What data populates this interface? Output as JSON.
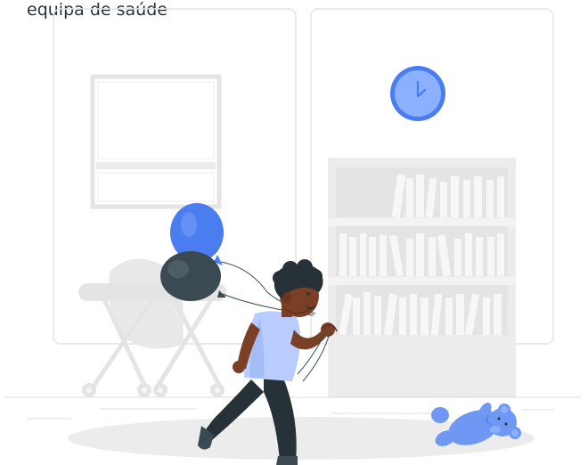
{
  "caption": "equipa de saúde",
  "colors": {
    "accent": "#4a7df0",
    "accent_light": "#8ab0ff",
    "line_gray": "#e4e4e4",
    "fill_gray": "#ececec",
    "dark": "#263238",
    "skin": "#7a4025",
    "shirt": "#b8ccff",
    "pants": "#263238"
  },
  "icons": [
    "wall-clock-icon",
    "bookshelf-icon",
    "window-icon",
    "balloon-icon",
    "baby-stroller-icon",
    "teddy-bear-icon",
    "child-figure-icon"
  ]
}
